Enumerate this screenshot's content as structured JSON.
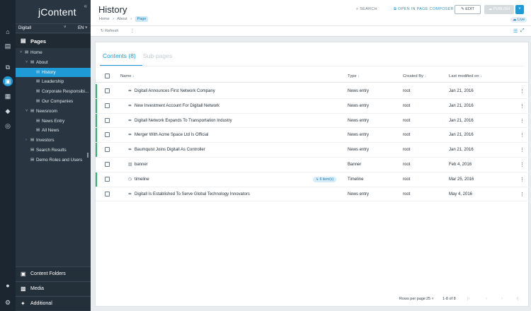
{
  "app": {
    "logo": "jContent"
  },
  "rail": {
    "icons": [
      "home-icon",
      "clipboard-icon",
      "copy-icon",
      "page-composer-icon",
      "content-icon",
      "grid-icon",
      "tag-icon",
      "compass-icon",
      "user-icon",
      "gear-icon"
    ],
    "glyphs": [
      "⌂",
      "▤",
      "⧉",
      "❐",
      "▣",
      "▦",
      "◆",
      "◎",
      "●",
      "⚙"
    ]
  },
  "sidebar": {
    "collapse_glyph": "«",
    "site": "Digitall",
    "site_chevron": "˅",
    "language": "EN ˅",
    "pages_label": "Pages",
    "pages_glyph": "▤",
    "tree": [
      {
        "label": "Home",
        "toggle": "˅"
      },
      {
        "label": "About",
        "toggle": "˅"
      },
      {
        "label": "History",
        "toggle": "",
        "selected": true
      },
      {
        "label": "Leadership",
        "toggle": ""
      },
      {
        "label": "Corporate Responsibi...",
        "toggle": ""
      },
      {
        "label": "Our Companies",
        "toggle": ""
      },
      {
        "label": "Newsroom",
        "toggle": "˅"
      },
      {
        "label": "News Entry",
        "toggle": ""
      },
      {
        "label": "All News",
        "toggle": ""
      },
      {
        "label": "Investors",
        "toggle": "›"
      },
      {
        "label": "Search Results",
        "toggle": ""
      },
      {
        "label": "Demo Roles and Users",
        "toggle": ""
      }
    ],
    "footer": [
      {
        "label": "Content Folders",
        "glyph": "▣"
      },
      {
        "label": "Media",
        "glyph": "▩"
      },
      {
        "label": "Additional",
        "glyph": "✦"
      }
    ]
  },
  "header": {
    "title": "History",
    "breadcrumb": [
      "Home",
      "About"
    ],
    "breadcrumb_sep": "›",
    "badge": "Page",
    "search": "⌕  SEARCH",
    "composer": "⧉  OPEN IN PAGE COMPOSER",
    "edit": "✎  EDIT",
    "publish": "☁  PUBLISH",
    "publish_dropdown": "˅",
    "status": "☁ Live"
  },
  "toolbar": {
    "refresh": "↻  Refresh",
    "more": "⋮",
    "list_view": "☰",
    "expand": "⤢"
  },
  "tabs": {
    "contents": "Contents (8)",
    "subpages": "Sub-pages"
  },
  "table": {
    "columns": {
      "name": "Name",
      "type": "Type",
      "created_by": "Created By",
      "last_modified": "Last modified on"
    },
    "sort_glyph": "↓",
    "rows": [
      {
        "name": "Digitall Announces First Network Company",
        "type": "News entry",
        "created_by": "root",
        "modified": "Jan 21, 2016",
        "icon": "⬌",
        "badge": "",
        "published": true
      },
      {
        "name": "New Investment Account For Digitall Network",
        "type": "News entry",
        "created_by": "root",
        "modified": "Jan 21, 2016",
        "icon": "⬌",
        "badge": "",
        "published": true
      },
      {
        "name": "Digitall Network Expands To Transportation Industry",
        "type": "News entry",
        "created_by": "root",
        "modified": "Jan 21, 2016",
        "icon": "⬌",
        "badge": "",
        "published": true
      },
      {
        "name": "Merger With Acme Space Ltd Is Official",
        "type": "News entry",
        "created_by": "root",
        "modified": "Jan 21, 2016",
        "icon": "⬌",
        "badge": "",
        "published": true
      },
      {
        "name": "Baumquist Joins Digitall As Controller",
        "type": "News entry",
        "created_by": "root",
        "modified": "Jan 21, 2016",
        "icon": "⬌",
        "badge": "",
        "published": true
      },
      {
        "name": "banner",
        "type": "Banner",
        "created_by": "root",
        "modified": "Feb 4, 2016",
        "icon": "▧",
        "badge": "",
        "published": false
      },
      {
        "name": "timeline",
        "type": "Timeline",
        "created_by": "root",
        "modified": "Mar 25, 2016",
        "icon": "◷",
        "badge": "↳ 6 item(s)",
        "published": true
      },
      {
        "name": "Digitall Is Established To Serve Global Technology Innovators",
        "type": "News entry",
        "created_by": "root",
        "modified": "May 4, 2016",
        "icon": "⬌",
        "badge": "",
        "published": false
      }
    ],
    "row_menu": "⋮"
  },
  "pagination": {
    "rows_label": "Rows per page",
    "rows_value": "25",
    "rows_chevron": "˅",
    "range": "1-8 of 8",
    "first": "|‹",
    "prev": "‹",
    "next": "›",
    "last": "›|"
  },
  "colors": {
    "accent": "#1e9bd7",
    "published": "#2fb46c",
    "sidebar": "#293540",
    "rail": "#1b2630"
  }
}
